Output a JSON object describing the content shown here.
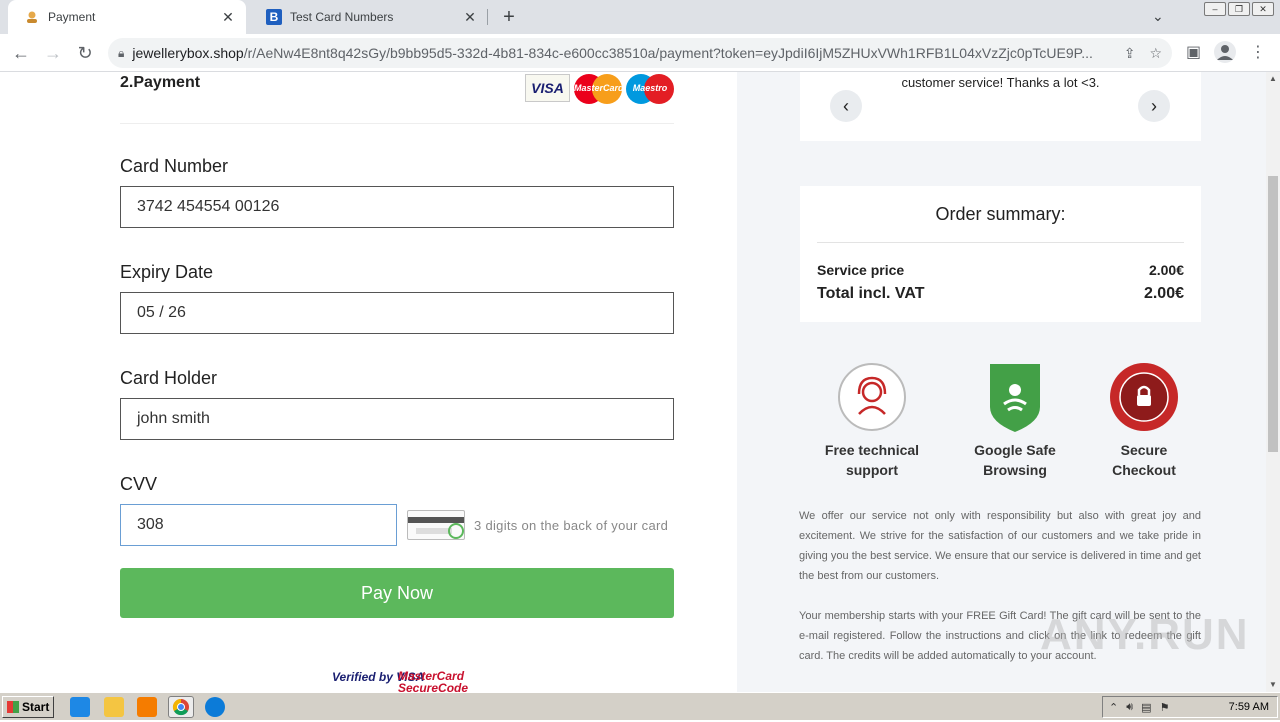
{
  "browser": {
    "tabs": [
      {
        "label": "Payment",
        "active": true
      },
      {
        "label": "Test Card Numbers",
        "active": false
      }
    ],
    "url_host": "jewellerybox.shop",
    "url_path": "/r/AeNw4E8nt8q42sGy/b9bb95d5-332d-4b81-834c-e600cc38510a/payment?token=eyJpdiI6IjM5ZHUxVWh1RFB1L04xVzZjc0pTcUE9P..."
  },
  "payment": {
    "section_title": "2.Payment",
    "card_brands": [
      "VISA",
      "MasterCard",
      "Maestro"
    ],
    "card_number_label": "Card Number",
    "card_number_value": "3742 454554 00126",
    "expiry_label": "Expiry Date",
    "expiry_value": "05 / 26",
    "holder_label": "Card Holder",
    "holder_value": "john smith",
    "cvv_label": "CVV",
    "cvv_value": "308",
    "cvv_hint": "3 digits on the back of your card",
    "pay_button": "Pay Now",
    "verified_by": "Verified by VISA",
    "mc_secure_1": "MasterCard",
    "mc_secure_2": "SecureCode"
  },
  "review": {
    "text": "customer service! Thanks a lot <3."
  },
  "summary": {
    "title": "Order summary:",
    "service_label": "Service price",
    "service_value": "2.00€",
    "total_label": "Total incl. VAT",
    "total_value": "2.00€"
  },
  "badges": {
    "support_1": "Free technical",
    "support_2": "support",
    "safe_1": "Google Safe",
    "safe_2": "Browsing",
    "secure_1": "Secure",
    "secure_2": "Checkout"
  },
  "info": {
    "para1": "We offer our service not only with responsibility but also with great joy and excitement. We strive for the satisfaction of our customers and we take pride in giving you the best service. We ensure that our service is delivered in time and get the best from our customers.",
    "para2": "Your membership starts with your FREE Gift Card! The gift card will be sent to the e-mail registered. Follow the instructions and click on the link to redeem the gift card. The credits will be added automatically to your account."
  },
  "watermark": "ANY.RUN",
  "taskbar": {
    "start": "Start",
    "clock": "7:59 AM"
  },
  "colors": {
    "pay_button": "#5cb85c",
    "right_panel_bg": "#f3f5f8"
  }
}
